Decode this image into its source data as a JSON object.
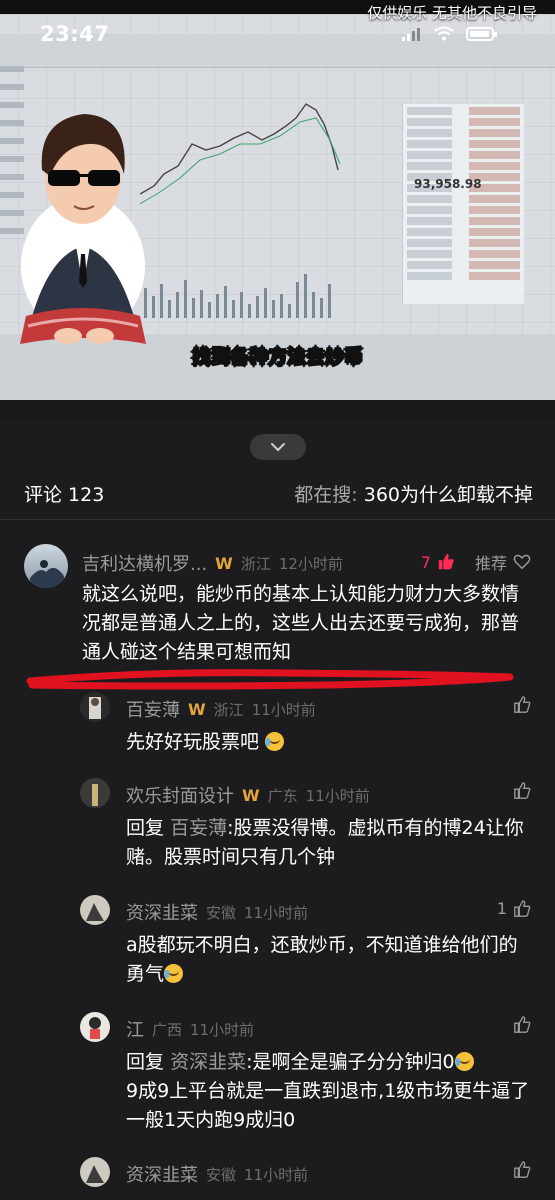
{
  "status_bar": {
    "time": "23:47"
  },
  "video": {
    "watermark": "仅供娱乐 无其他不良引导",
    "caption": "找到各种方法去炒币",
    "price_readout": "93,958.98"
  },
  "comments_header": {
    "title": "评论 123",
    "search_prefix": "都在搜:",
    "search_query": "360为什么卸载不掉"
  },
  "comments": [
    {
      "user": "吉利达横机罗...",
      "region": "浙江",
      "time": "12小时前",
      "likes": "7",
      "action": "推荐",
      "text": "就这么说吧，能炒币的基本上认知能力财力大多数情况都是普通人之上的，这些人出去还要亏成狗，那普通人碰这个结果可想而知"
    },
    {
      "user": "百妄薄",
      "region": "浙江",
      "time": "11小时前",
      "likes": "",
      "text": "先好好玩股票吧"
    },
    {
      "user": "欢乐封面设计",
      "region": "广东",
      "time": "11小时前",
      "likes": "",
      "reply_prefix": "回复",
      "reply_to": "百妄薄",
      "text": ":股票没得博。虚拟币有的博24让你赌。股票时间只有几个钟"
    },
    {
      "user": "资深韭菜",
      "region": "安徽",
      "time": "11小时前",
      "likes": "1",
      "text": "a股都玩不明白，还敢炒币，不知道谁给他们的勇气"
    },
    {
      "user": "江",
      "region": "广西",
      "time": "11小时前",
      "likes": "",
      "reply_prefix": "回复",
      "reply_to": "资深韭菜",
      "text": ":是啊全是骗子分分钟归0",
      "text2": "9成9上平台就是一直跌到退市,1级市场更牛逼了一般1天内跑9成归0"
    },
    {
      "user": "资深韭菜",
      "region": "安徽",
      "time": "11小时前",
      "likes": ""
    }
  ],
  "colors": {
    "accent_red": "#fe2c55",
    "badge_gold": "#e4a53b",
    "underline_red": "#e0121f"
  }
}
